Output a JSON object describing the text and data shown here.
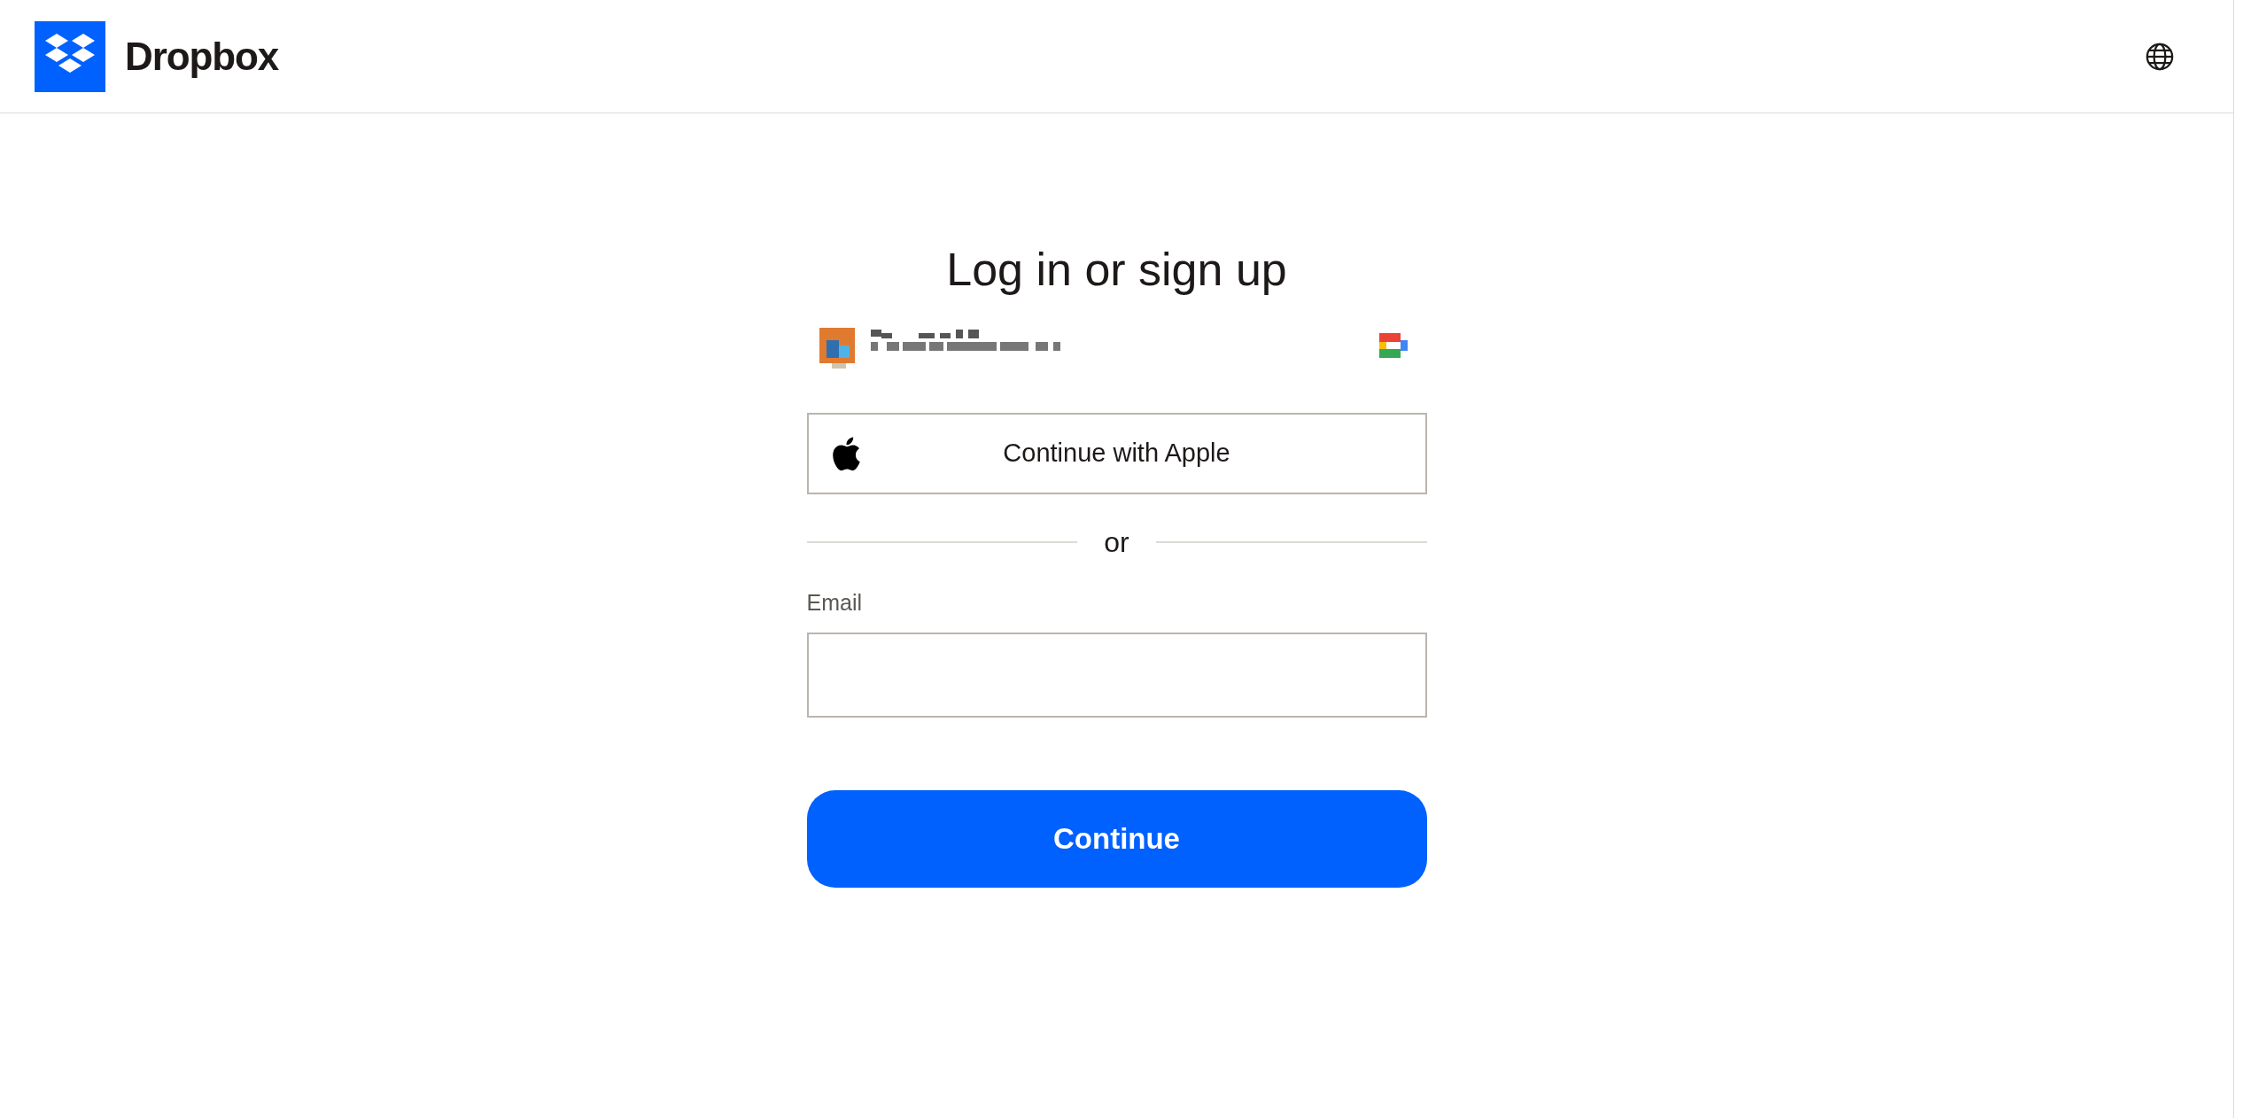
{
  "header": {
    "brand": "Dropbox"
  },
  "form": {
    "title": "Log in or sign up",
    "apple_button": {
      "label": "Continue with Apple"
    },
    "divider": "or",
    "email": {
      "label": "Email"
    },
    "submit": {
      "label": "Continue"
    }
  }
}
